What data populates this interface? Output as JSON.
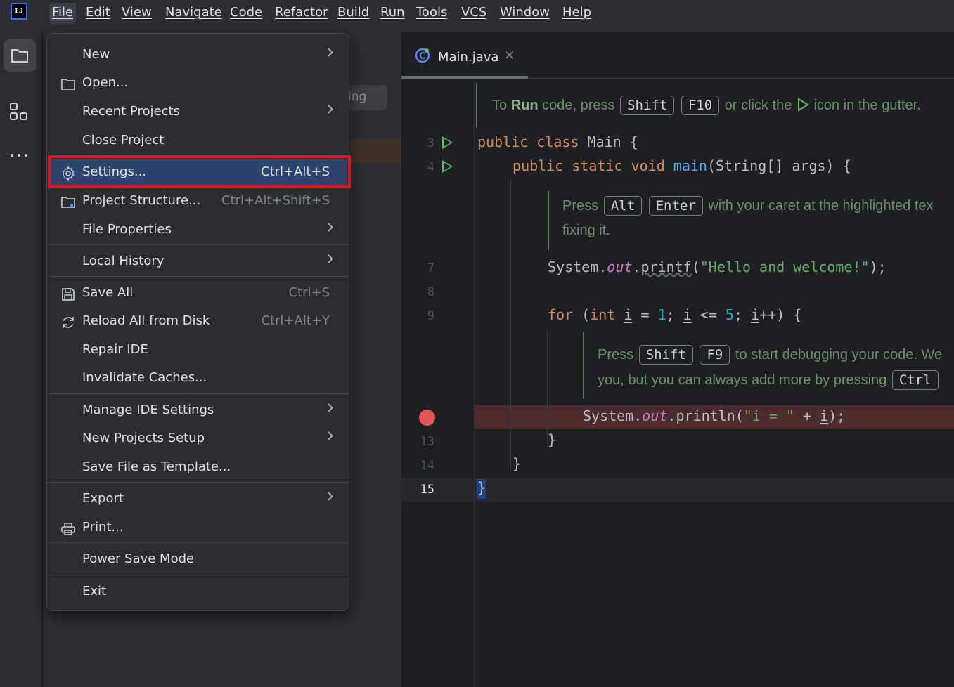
{
  "menubar": {
    "logo_text": "IJ",
    "items": [
      "File",
      "Edit",
      "View",
      "Navigate",
      "Code",
      "Refactor",
      "Build",
      "Run",
      "Tools",
      "VCS",
      "Window",
      "Help"
    ]
  },
  "project_panel": {
    "partial_text": "ing"
  },
  "editor": {
    "tab_label": "Main.java",
    "tab_close": "×",
    "hints": {
      "run_prefix": "To",
      "run_bold": "Run",
      "run_mid": "code, press",
      "run_key1": "Shift",
      "run_key2": "F10",
      "run_suffix": "or click the",
      "run_suffix2": "icon in the gutter.",
      "fix_prefix": "Press",
      "fix_key1": "Alt",
      "fix_key2": "Enter",
      "fix_suffix": "with your caret at the highlighted tex",
      "fix_line2": "fixing it.",
      "debug_prefix": "Press",
      "debug_key1": "Shift",
      "debug_key2": "F9",
      "debug_suffix": "to start debugging your code. We",
      "debug_line2": "you, but you can always add more by pressing",
      "debug_key3": "Ctrl"
    },
    "line_numbers": [
      "3",
      "4",
      "7",
      "8",
      "9",
      "13",
      "14",
      "15"
    ]
  },
  "file_menu": {
    "new": "New",
    "open": "Open...",
    "recent_projects": "Recent Projects",
    "close_project": "Close Project",
    "settings": "Settings...",
    "settings_shortcut": "Ctrl+Alt+S",
    "project_structure": "Project Structure...",
    "project_structure_shortcut": "Ctrl+Alt+Shift+S",
    "file_properties": "File Properties",
    "local_history": "Local History",
    "save_all": "Save All",
    "save_all_shortcut": "Ctrl+S",
    "reload": "Reload All from Disk",
    "reload_shortcut": "Ctrl+Alt+Y",
    "repair_ide": "Repair IDE",
    "invalidate_caches": "Invalidate Caches...",
    "manage_ide_settings": "Manage IDE Settings",
    "new_projects_setup": "New Projects Setup",
    "save_file_as_template": "Save File as Template...",
    "export": "Export",
    "print": "Print...",
    "power_save_mode": "Power Save Mode",
    "exit": "Exit"
  },
  "colors": {
    "accent": "#3574f0",
    "selection": "#2e436e",
    "highlight_box": "#e8101c",
    "breakpoint": "#e55757",
    "run_icon": "#5fb865"
  }
}
